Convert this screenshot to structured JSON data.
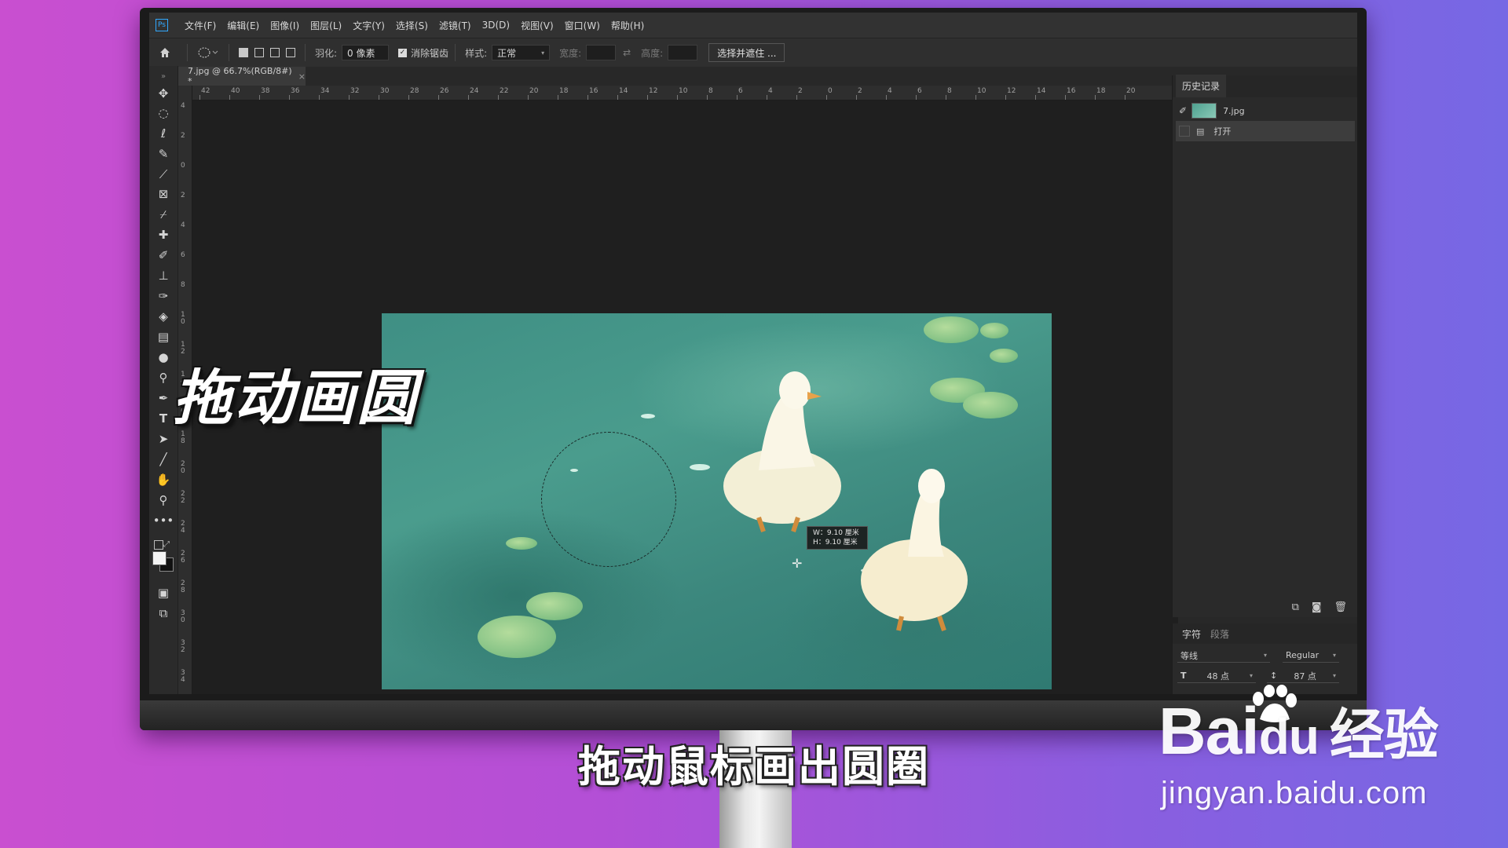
{
  "menubar": {
    "logo": "Ps",
    "items": [
      "文件(F)",
      "编辑(E)",
      "图像(I)",
      "图层(L)",
      "文字(Y)",
      "选择(S)",
      "滤镜(T)",
      "3D(D)",
      "视图(V)",
      "窗口(W)",
      "帮助(H)"
    ]
  },
  "options": {
    "feather_label": "羽化:",
    "feather_value": "0 像素",
    "antialias_label": "消除锯齿",
    "antialias_checked": true,
    "style_label": "样式:",
    "style_value": "正常",
    "width_label": "宽度:",
    "height_label": "高度:",
    "select_mask_label": "选择并遮住 ..."
  },
  "document": {
    "tab_title": "7.jpg @ 66.7%(RGB/8#) *",
    "close_glyph": "×"
  },
  "ruler": {
    "top_ticks": [
      "42",
      "40",
      "38",
      "36",
      "34",
      "32",
      "30",
      "28",
      "26",
      "24",
      "22",
      "20",
      "18",
      "16",
      "14",
      "12",
      "10",
      "8",
      "6",
      "4",
      "2",
      "0",
      "2",
      "4",
      "6",
      "8",
      "10",
      "12",
      "14",
      "16",
      "18",
      "20"
    ],
    "left_ticks": [
      "4",
      "2",
      "0",
      "2",
      "4",
      "6",
      "8",
      "1 0",
      "1 2",
      "1 4",
      "1 6",
      "1 8",
      "2 0",
      "2 2",
      "2 4",
      "2 6",
      "2 8",
      "3 0",
      "3 2",
      "3 4"
    ]
  },
  "selection_tooltip": {
    "w": "W：9.10 厘米",
    "h": "H：9.10 厘米"
  },
  "history_panel": {
    "tab": "历史记录",
    "snapshot_name": "7.jpg",
    "step": "打开"
  },
  "character_panel": {
    "tab_char": "字符",
    "tab_para": "段落",
    "font_family": "等线",
    "font_style": "Regular",
    "font_size": "48 点",
    "leading": "87 点"
  },
  "overlay": {
    "big_caption": "拖动画圆",
    "subtitle": "拖动鼠标画出圆圈",
    "watermark_brand_left": "Bai",
    "watermark_brand_mid": "du",
    "watermark_brand_right": "经验",
    "watermark_url": "jingyan.baidu.com"
  },
  "colors": {
    "background_left": "#c94fd0",
    "background_right": "#7668e4",
    "ps_accent": "#31a8ff",
    "water": "#4a9c8d"
  }
}
